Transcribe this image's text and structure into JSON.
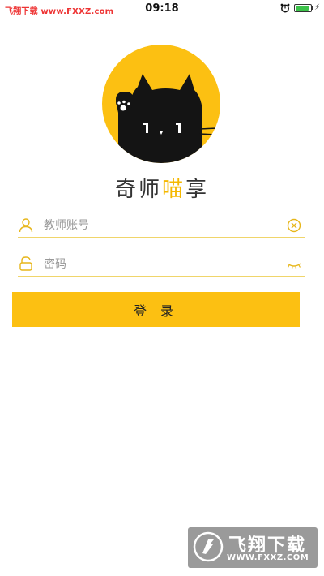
{
  "status_bar": {
    "carrier": "飞翔下载 www.FXXZ.com",
    "time": "09:18",
    "battery_level_pct": 90,
    "icons": [
      "alarm-icon",
      "battery-icon",
      "charging-icon"
    ]
  },
  "app": {
    "name_part1": "奇师",
    "name_accent": "喵",
    "name_part2": "享"
  },
  "form": {
    "account_placeholder": "教师账号",
    "password_placeholder": "密码",
    "login_label": "登 录"
  },
  "watermark": {
    "text": "飞翔下载",
    "url": "WWW.FXXZ.COM"
  },
  "colors": {
    "accent": "#fcc012",
    "underline": "#f0d56a"
  }
}
